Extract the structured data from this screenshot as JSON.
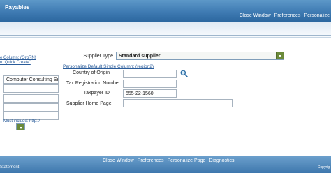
{
  "app": {
    "title": "Payables"
  },
  "global_links": [
    "Close Window",
    "Preferences",
    "Personalize"
  ],
  "left_region": {
    "link1": "e Column: (OrgRN)",
    "link2": "n: Quick Create\"",
    "field_value": "Computer Consulting Ser",
    "must_include": "Must include: http://"
  },
  "form": {
    "supplier_type": {
      "label": "Supplier Type",
      "value": "Standard supplier"
    },
    "personalize_link": "Personalize Default Single Column: (region2)",
    "country": {
      "label": "Country of Origin",
      "value": ""
    },
    "tax_reg": {
      "label": "Tax Registration Number",
      "value": ""
    },
    "taxpayer": {
      "label": "Taxpayer ID",
      "value": "555-22-1560"
    },
    "home_page": {
      "label": "Supplier Home Page",
      "value": ""
    }
  },
  "footer": {
    "links": [
      "Close Window",
      "Preferences",
      "Personalize Page",
      "Diagnostics"
    ],
    "left_text": "Statement",
    "right_text": "Copyrig"
  },
  "colors": {
    "header": "#3f7bb3",
    "link": "#2a5c9a",
    "select_arrow": "#6b8a3a"
  }
}
